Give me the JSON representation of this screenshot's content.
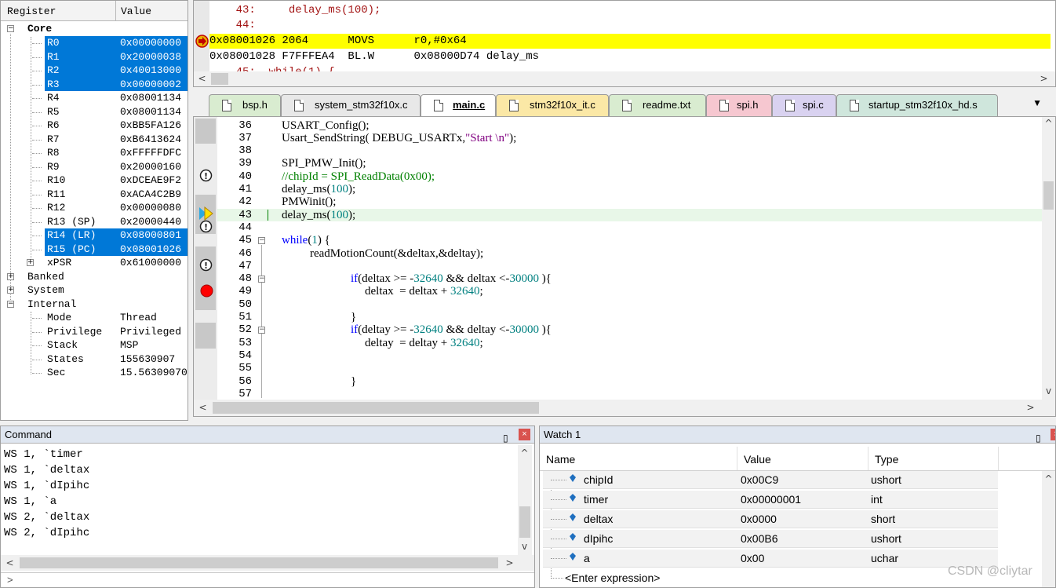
{
  "registers": {
    "header": {
      "register": "Register",
      "value": "Value"
    },
    "groups": [
      {
        "label": "Core"
      },
      {
        "label": "Banked"
      },
      {
        "label": "System"
      },
      {
        "label": "Internal"
      }
    ],
    "core": [
      {
        "name": "R0",
        "value": "0x00000000"
      },
      {
        "name": "R1",
        "value": "0x20000038"
      },
      {
        "name": "R2",
        "value": "0x40013000"
      },
      {
        "name": "R3",
        "value": "0x00000002"
      },
      {
        "name": "R4",
        "value": "0x08001134"
      },
      {
        "name": "R5",
        "value": "0x08001134"
      },
      {
        "name": "R6",
        "value": "0xBB5FA126"
      },
      {
        "name": "R7",
        "value": "0xB6413624"
      },
      {
        "name": "R8",
        "value": "0xFFFFFDFC"
      },
      {
        "name": "R9",
        "value": "0x20000160"
      },
      {
        "name": "R10",
        "value": "0xDCEAE9F2"
      },
      {
        "name": "R11",
        "value": "0xACA4C2B9"
      },
      {
        "name": "R12",
        "value": "0x00000080"
      },
      {
        "name": "R13 (SP)",
        "value": "0x20000440"
      },
      {
        "name": "R14 (LR)",
        "value": "0x08000801"
      },
      {
        "name": "R15 (PC)",
        "value": "0x08001026"
      },
      {
        "name": "xPSR",
        "value": "0x61000000"
      }
    ],
    "internal": [
      {
        "name": "Mode",
        "value": "Thread"
      },
      {
        "name": "Privilege",
        "value": "Privileged"
      },
      {
        "name": "Stack",
        "value": "MSP"
      },
      {
        "name": "States",
        "value": "155630907"
      },
      {
        "name": "Sec",
        "value": "15.56309070"
      }
    ]
  },
  "disassembly": [
    "    43:     delay_ms(100);",
    "    44: ",
    "0x08001026 2064      MOVS      r0,#0x64",
    "0x08001028 F7FFFEA4  BL.W      0x08000D74 delay_ms",
    "    45:  while(1) {"
  ],
  "tabs": [
    {
      "label": "bsp.h",
      "color": "#d9ecd0"
    },
    {
      "label": "system_stm32f10x.c",
      "color": "#e8e8e8"
    },
    {
      "label": "main.c",
      "color": "#ffffff"
    },
    {
      "label": "stm32f10x_it.c",
      "color": "#fbe8a6"
    },
    {
      "label": "readme.txt",
      "color": "#d9ecd0"
    },
    {
      "label": "spi.h",
      "color": "#f6c7d0"
    },
    {
      "label": "spi.c",
      "color": "#d9d2f0"
    },
    {
      "label": "startup_stm32f10x_hd.s",
      "color": "#cfe6dc"
    }
  ],
  "editor": {
    "line_numbers": [
      "36",
      "37",
      "38",
      "39",
      "40",
      "41",
      "42",
      "43",
      "44",
      "45",
      "46",
      "47",
      "48",
      "49",
      "50",
      "51",
      "52",
      "53",
      "54",
      "55",
      "56",
      "57"
    ],
    "code": {
      "l36": "USART_Config();",
      "l37a": "Usart_SendString( DEBUG_USARTx,",
      "l37b": "\"Start \\n\"",
      "l37c": ");",
      "l39": "SPI_PMW_Init();",
      "l40": "//chipId = SPI_ReadData(0x00);",
      "l41a": "delay_ms(",
      "l41b": "100",
      "l41c": ");",
      "l42": "PMWinit();",
      "l43a": "delay_ms(",
      "l43b": "100",
      "l43c": ");",
      "l45a": "while",
      "l45b": "(",
      "l45c": "1",
      "l45d": ") {",
      "l46": "readMotionCount(&deltax,&deltay);",
      "l48a": "if",
      "l48b": "(deltax >= -",
      "l48c": "32640",
      "l48d": " && deltax <-",
      "l48e": "30000",
      "l48f": " ){",
      "l49a": "deltax  = deltax + ",
      "l49b": "32640",
      "l49c": ";",
      "l51": "}",
      "l52a": "if",
      "l52b": "(deltay >= -",
      "l52c": "32640",
      "l52d": " && deltay <-",
      "l52e": "30000",
      "l52f": " ){",
      "l53a": "deltay  = deltay + ",
      "l53b": "32640",
      "l53c": ";",
      "l56": "}"
    }
  },
  "command": {
    "title": "Command",
    "lines": [
      "WS 1, `timer",
      "WS 1, `deltax",
      "WS 1, `dIpihc",
      "WS 1, `a",
      "WS 2, `deltax",
      "WS 2, `dIpihc"
    ],
    "prompt": ">"
  },
  "watch": {
    "title": "Watch 1",
    "columns": {
      "name": "Name",
      "value": "Value",
      "type": "Type"
    },
    "rows": [
      {
        "name": "chipId",
        "value": "0x00C9",
        "type": "ushort"
      },
      {
        "name": "timer",
        "value": "0x00000001",
        "type": "int"
      },
      {
        "name": "deltax",
        "value": "0x0000",
        "type": "short"
      },
      {
        "name": "dIpihc",
        "value": "0x00B6",
        "type": "ushort"
      },
      {
        "name": "a",
        "value": "0x00",
        "type": "uchar"
      }
    ],
    "enter_expression": "<Enter expression>"
  },
  "watermark": "CSDN @cliytar",
  "colors": {
    "selection": "#0078d7",
    "current_line": "#ffff00",
    "keyword": "#0000ff",
    "comment": "#008000",
    "number": "#008080",
    "string": "#800080",
    "breakpoint": "#ff0000"
  }
}
